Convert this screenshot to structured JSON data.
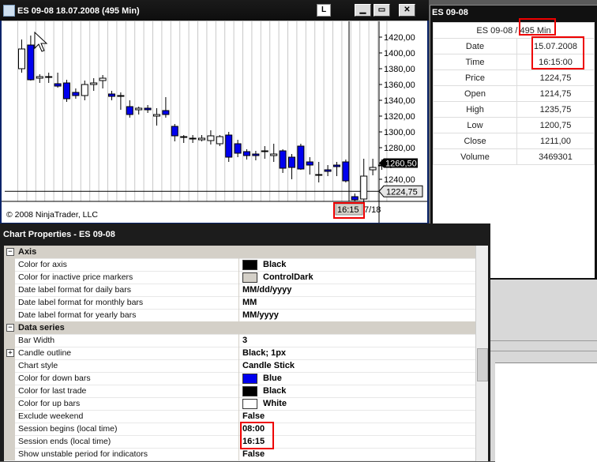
{
  "chart_window": {
    "title": "ES 09-08  18.07.2008 (495 Min)",
    "legend_letter": "L",
    "copyright": "© 2008 NinjaTrader, LLC",
    "price_ticks": [
      "1420,00",
      "1400,00",
      "1380,00",
      "1360,00",
      "1340,00",
      "1320,00",
      "1300,00",
      "1280,00",
      "1260,00",
      "1240,00"
    ],
    "last_price_marker": "1260,50",
    "crosshair_price": "1224,75",
    "crosshair_time": "16:15",
    "date_tick": "7/18",
    "colors": {
      "down_bar": "#0000ee",
      "up_bar": "#ffffff",
      "outline": "#000000",
      "last_marker_bg": "#000000",
      "inactive_marker": "#d4d0c8"
    }
  },
  "chart_data": {
    "type": "candlestick",
    "ylim": [
      1205,
      1430
    ],
    "candles": [
      {
        "o": 1380,
        "h": 1417,
        "l": 1375,
        "c": 1405
      },
      {
        "o": 1410,
        "h": 1422,
        "l": 1365,
        "c": 1366
      },
      {
        "o": 1368,
        "h": 1373,
        "l": 1362,
        "c": 1370
      },
      {
        "o": 1370,
        "h": 1375,
        "l": 1362,
        "c": 1369
      },
      {
        "o": 1361,
        "h": 1375,
        "l": 1356,
        "c": 1358
      },
      {
        "o": 1362,
        "h": 1366,
        "l": 1338,
        "c": 1342
      },
      {
        "o": 1350,
        "h": 1355,
        "l": 1342,
        "c": 1346
      },
      {
        "o": 1346,
        "h": 1365,
        "l": 1340,
        "c": 1360
      },
      {
        "o": 1360,
        "h": 1368,
        "l": 1352,
        "c": 1362
      },
      {
        "o": 1365,
        "h": 1372,
        "l": 1355,
        "c": 1368
      },
      {
        "o": 1348,
        "h": 1352,
        "l": 1340,
        "c": 1345
      },
      {
        "o": 1346,
        "h": 1350,
        "l": 1328,
        "c": 1346
      },
      {
        "o": 1332,
        "h": 1340,
        "l": 1318,
        "c": 1322
      },
      {
        "o": 1328,
        "h": 1332,
        "l": 1322,
        "c": 1330
      },
      {
        "o": 1330,
        "h": 1334,
        "l": 1324,
        "c": 1328
      },
      {
        "o": 1320,
        "h": 1330,
        "l": 1308,
        "c": 1322
      },
      {
        "o": 1327,
        "h": 1344,
        "l": 1318,
        "c": 1322
      },
      {
        "o": 1307,
        "h": 1310,
        "l": 1288,
        "c": 1295
      },
      {
        "o": 1293,
        "h": 1296,
        "l": 1286,
        "c": 1294
      },
      {
        "o": 1292,
        "h": 1296,
        "l": 1286,
        "c": 1292
      },
      {
        "o": 1290,
        "h": 1296,
        "l": 1288,
        "c": 1292
      },
      {
        "o": 1289,
        "h": 1302,
        "l": 1284,
        "c": 1295
      },
      {
        "o": 1285,
        "h": 1296,
        "l": 1282,
        "c": 1294
      },
      {
        "o": 1296,
        "h": 1300,
        "l": 1262,
        "c": 1268
      },
      {
        "o": 1285,
        "h": 1290,
        "l": 1268,
        "c": 1273
      },
      {
        "o": 1275,
        "h": 1278,
        "l": 1265,
        "c": 1270
      },
      {
        "o": 1272,
        "h": 1276,
        "l": 1264,
        "c": 1270
      },
      {
        "o": 1275,
        "h": 1282,
        "l": 1266,
        "c": 1276
      },
      {
        "o": 1270,
        "h": 1285,
        "l": 1262,
        "c": 1272
      },
      {
        "o": 1276,
        "h": 1278,
        "l": 1248,
        "c": 1254
      },
      {
        "o": 1268,
        "h": 1272,
        "l": 1240,
        "c": 1255
      },
      {
        "o": 1282,
        "h": 1285,
        "l": 1252,
        "c": 1253
      },
      {
        "o": 1262,
        "h": 1268,
        "l": 1246,
        "c": 1258
      },
      {
        "o": 1246,
        "h": 1262,
        "l": 1236,
        "c": 1246
      },
      {
        "o": 1252,
        "h": 1258,
        "l": 1244,
        "c": 1250
      },
      {
        "o": 1258,
        "h": 1262,
        "l": 1244,
        "c": 1256
      },
      {
        "o": 1262,
        "h": 1265,
        "l": 1236,
        "c": 1238
      },
      {
        "o": 1218,
        "h": 1222,
        "l": 1212,
        "c": 1214
      },
      {
        "o": 1215,
        "h": 1266,
        "l": 1210,
        "c": 1244
      },
      {
        "o": 1252,
        "h": 1266,
        "l": 1245,
        "c": 1255
      },
      {
        "o": 1257,
        "h": 1265,
        "l": 1252,
        "c": 1258
      },
      {
        "o": 1258,
        "h": 1262,
        "l": 1254,
        "c": 1260.5
      }
    ]
  },
  "data_box": {
    "title": "ES 09-08",
    "instrument_prefix": "ES 09-08 / ",
    "interval": "495 Min",
    "rows": [
      {
        "label": "Date",
        "value": "15.07.2008"
      },
      {
        "label": "Time",
        "value": "16:15:00"
      },
      {
        "label": "Price",
        "value": "1224,75"
      },
      {
        "label": "Open",
        "value": "1214,75"
      },
      {
        "label": "High",
        "value": "1235,75"
      },
      {
        "label": "Low",
        "value": "1200,75"
      },
      {
        "label": "Close",
        "value": "1211,00"
      },
      {
        "label": "Volume",
        "value": "3469301"
      }
    ]
  },
  "properties": {
    "title": "Chart Properties - ES 09-08",
    "rows": [
      {
        "type": "category",
        "name": "Axis",
        "expander": "−"
      },
      {
        "name": "Color for axis",
        "value": "Black",
        "swatch": "#000000"
      },
      {
        "name": "Color for inactive price markers",
        "value": "ControlDark",
        "swatch": "#d4d0c8"
      },
      {
        "name": "Date label format for daily bars",
        "value": "MM/dd/yyyy"
      },
      {
        "name": "Date label format for monthly bars",
        "value": "MM"
      },
      {
        "name": "Date label format for yearly bars",
        "value": "MM/yyyy"
      },
      {
        "type": "category",
        "name": "Data series",
        "expander": "−"
      },
      {
        "name": "Bar Width",
        "value": "3"
      },
      {
        "name": "Candle outline",
        "value": "Black; 1px",
        "expander": "+"
      },
      {
        "name": "Chart style",
        "value": "Candle Stick"
      },
      {
        "name": "Color for down bars",
        "value": "Blue",
        "swatch": "#0000ee"
      },
      {
        "name": "Color for last trade",
        "value": "Black",
        "swatch": "#000000"
      },
      {
        "name": "Color for up bars",
        "value": "White",
        "swatch": "#ffffff"
      },
      {
        "name": "Exclude weekend",
        "value": "False"
      },
      {
        "name": "Session begins (local time)",
        "value": "08:00"
      },
      {
        "name": "Session ends (local time)",
        "value": "16:15"
      },
      {
        "name": "Show unstable period for indicators",
        "value": "False"
      }
    ]
  }
}
